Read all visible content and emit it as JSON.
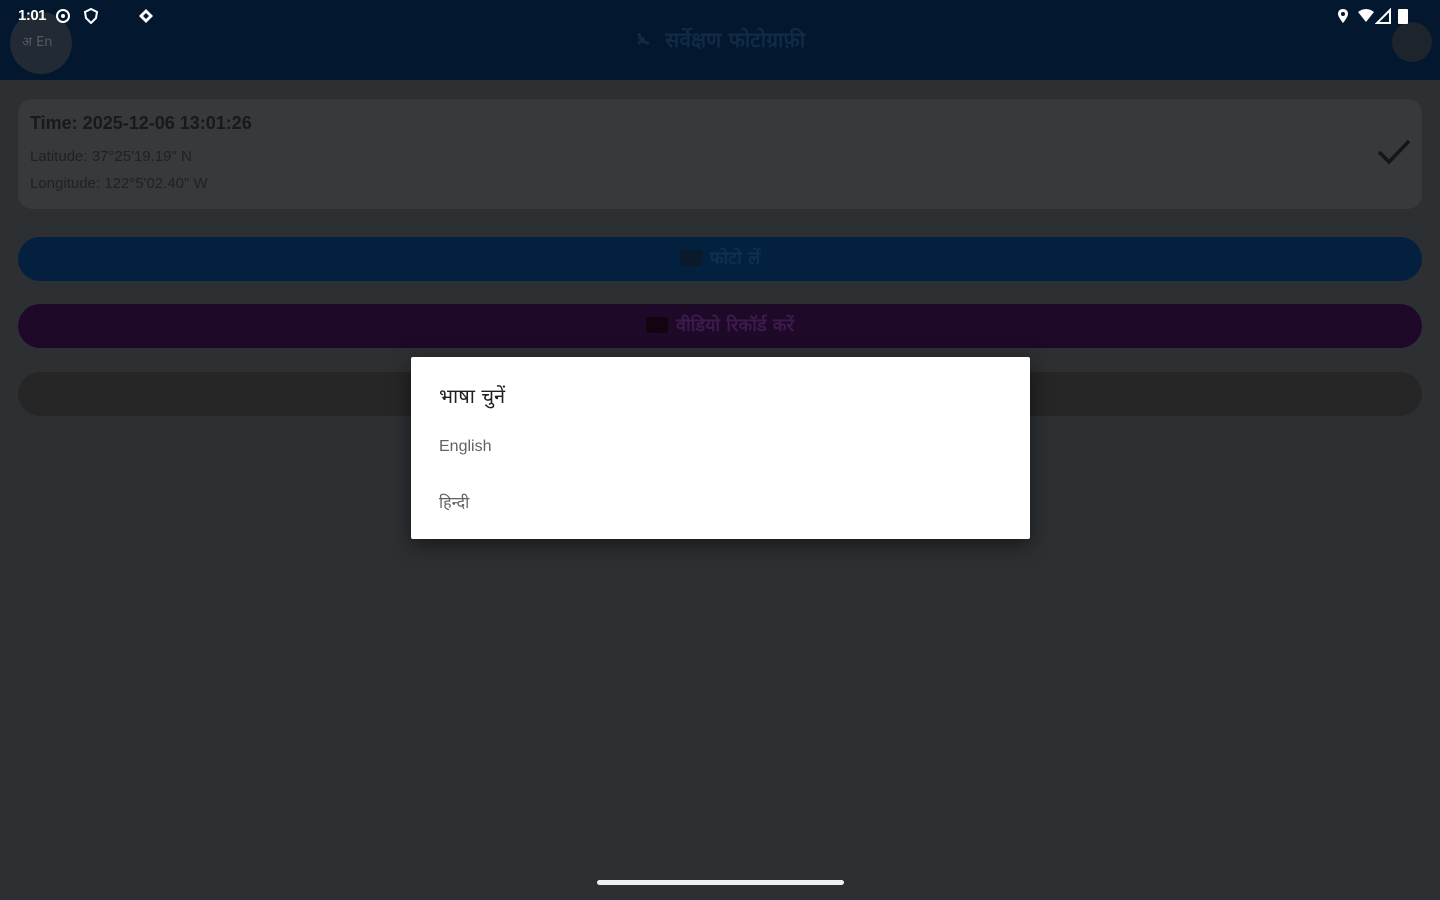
{
  "status_bar": {
    "time": "1:01"
  },
  "app_bar": {
    "lang_button_label": "अ En",
    "title_icon": "satellite-dish",
    "title": "सर्वेक्षण फोटोग्राफ़ी"
  },
  "info_card": {
    "time": "Time: 2025-12-06 13:01:26",
    "latitude": "Latitude: 37°25'19.19\" N",
    "longitude": "Longitude: 122°5'02.40\" W"
  },
  "buttons": {
    "photo": "फोटो लें",
    "video": "वीडियो रिकॉर्ड करें"
  },
  "dialog": {
    "title": "भाषा चुनें",
    "options": [
      "English",
      "हिन्दी"
    ]
  },
  "colors": {
    "app_bar": "#03182f",
    "scrim_bg": "#2d3033",
    "photo_button": "#03213f",
    "video_button": "#1f0928",
    "dialog_bg": "#ffffff"
  }
}
